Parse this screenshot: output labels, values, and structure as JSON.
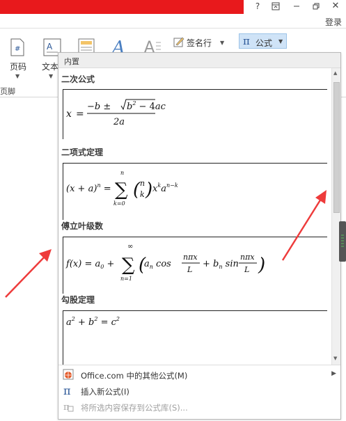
{
  "window": {
    "help": "?",
    "close": "✕",
    "login": "登录"
  },
  "ribbon": {
    "page_number_label": "页码",
    "text_label": "文本",
    "footer_partial_label": "页脚",
    "signature_line_label": "签名行",
    "equation_symbol": "π",
    "equation_label": "公式"
  },
  "panel": {
    "header": "内置",
    "sections": [
      {
        "title": "二次公式"
      },
      {
        "title": "二项式定理"
      },
      {
        "title": "傅立叶级数"
      },
      {
        "title": "勾股定理"
      }
    ],
    "menu": [
      {
        "label": "Office.com 中的其他公式(M)",
        "enabled": true,
        "has_submenu": true,
        "icon": "office-globe-icon"
      },
      {
        "label": "插入新公式(I)",
        "enabled": true,
        "has_submenu": false,
        "icon": "pi-icon"
      },
      {
        "label": "将所选内容保存到公式库(S)...",
        "enabled": false,
        "has_submenu": false,
        "icon": "save-to-gallery-icon"
      }
    ]
  },
  "colors": {
    "title_bar_red": "#e8191c",
    "equation_button_bg": "#cfe3f7",
    "annotation_arrow": "#ee3b3b",
    "pi_blue": "#2b5797"
  }
}
